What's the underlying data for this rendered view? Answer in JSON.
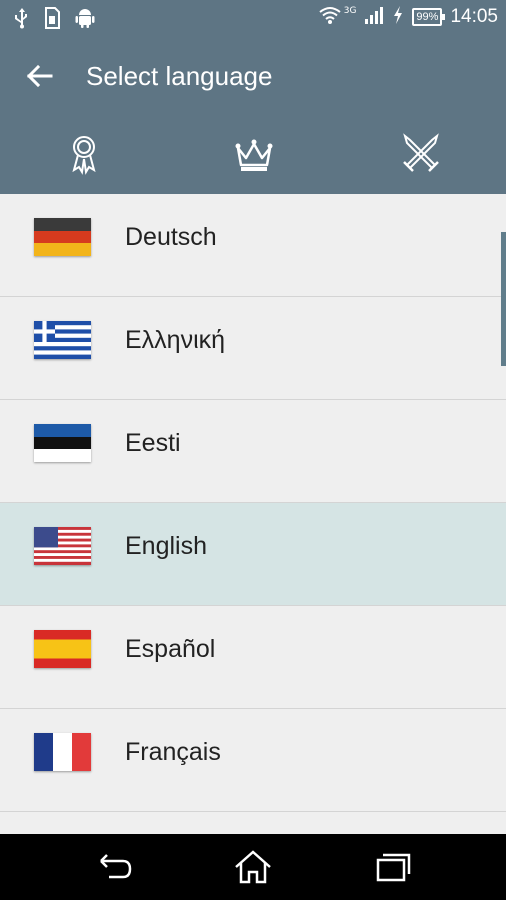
{
  "status_bar": {
    "network": "3G",
    "battery": "99%",
    "time": "14:05",
    "left_icons": [
      "usb-icon",
      "sim-card-icon",
      "android-icon"
    ],
    "right_icons": [
      "wifi-icon",
      "signal-icon",
      "charging-icon",
      "battery-icon"
    ]
  },
  "app_bar": {
    "title": "Select language",
    "back_icon": "arrow-left-icon",
    "tabs": [
      {
        "icon": "award-ribbon-icon"
      },
      {
        "icon": "crown-icon"
      },
      {
        "icon": "crossed-swords-icon"
      }
    ]
  },
  "languages": [
    {
      "label": "Deutsch",
      "flag": "flag-germany",
      "selected": false
    },
    {
      "label": "Ελληνική",
      "flag": "flag-greece",
      "selected": false
    },
    {
      "label": "Eesti",
      "flag": "flag-estonia",
      "selected": false
    },
    {
      "label": "English",
      "flag": "flag-usa",
      "selected": true
    },
    {
      "label": "Español",
      "flag": "flag-spain",
      "selected": false
    },
    {
      "label": "Français",
      "flag": "flag-france",
      "selected": false
    }
  ],
  "nav_bar": {
    "icons": [
      "back-icon",
      "home-icon",
      "recent-apps-icon"
    ]
  },
  "colors": {
    "primary": "#5e7584",
    "list_background": "#efefef",
    "selected_row": "#d5e4e4",
    "divider": "#d4d4d4"
  }
}
